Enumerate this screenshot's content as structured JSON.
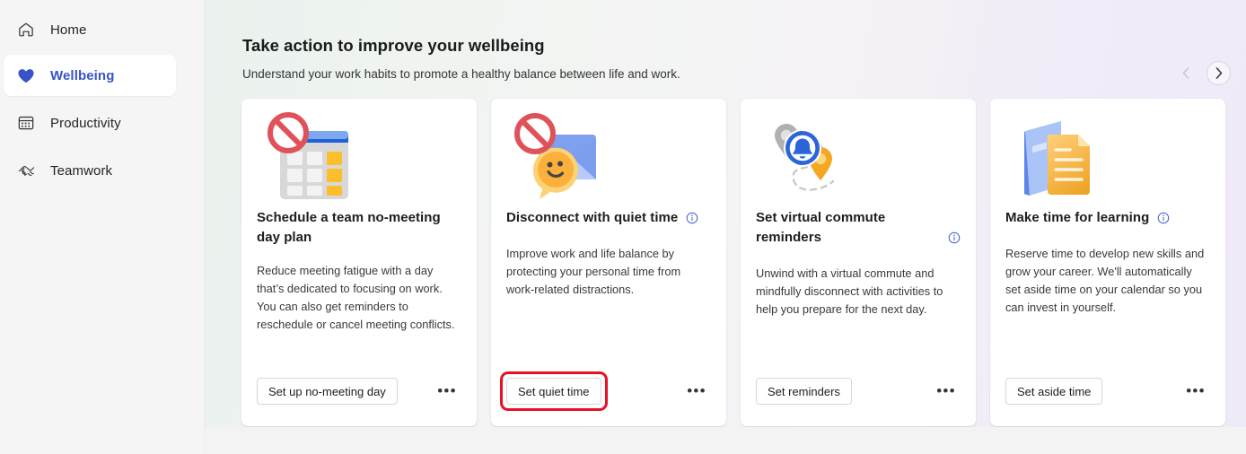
{
  "sidebar": {
    "items": [
      {
        "id": "home",
        "label": "Home",
        "icon": "home-icon",
        "active": false
      },
      {
        "id": "wellbeing",
        "label": "Wellbeing",
        "icon": "heart-icon",
        "active": true
      },
      {
        "id": "productivity",
        "label": "Productivity",
        "icon": "calendar-icon",
        "active": false
      },
      {
        "id": "teamwork",
        "label": "Teamwork",
        "icon": "handshake-icon",
        "active": false
      }
    ],
    "active_color": "#3754c8"
  },
  "header": {
    "title": "Take action to improve your wellbeing",
    "subtitle": "Understand your work habits to promote a healthy balance between life and work.",
    "prev_label": "‹",
    "next_label": "›"
  },
  "cards": [
    {
      "id": "no-meeting-day",
      "art": "calendar-blocked-illustration",
      "title": "Schedule a team no-meeting day plan",
      "body": "Reduce meeting fatigue with a day that’s dedicated to focusing on work. You can also get reminders to reschedule or cancel meeting conflicts.",
      "action": "Set up no-meeting day",
      "more": "•••",
      "has_info": false,
      "highlighted": false
    },
    {
      "id": "quiet-time",
      "art": "envelope-blocked-chat-illustration",
      "title": "Disconnect with quiet time",
      "body": "Improve work and life balance by protecting your personal time from work-related distractions.",
      "action": "Set quiet time",
      "more": "•••",
      "has_info": true,
      "highlighted": true
    },
    {
      "id": "virtual-commute",
      "art": "map-pins-bell-illustration",
      "title": "Set virtual commute reminders",
      "body": "Unwind with a virtual commute and mindfully disconnect with activities to help you prepare for the next day.",
      "action": "Set reminders",
      "more": "•••",
      "has_info": true,
      "highlighted": false
    },
    {
      "id": "learning-time",
      "art": "book-document-illustration",
      "title": "Make time for learning",
      "body": "Reserve time to develop new skills and grow your career. We'll automatically set aside time on your calendar so you can invest in yourself.",
      "action": "Set aside time",
      "more": "•••",
      "has_info": true,
      "highlighted": false
    }
  ],
  "colors": {
    "accent_blue": "#3754c8",
    "highlight_red": "#e81123",
    "illustration_blue": "#2b65d9",
    "illustration_yellow": "#f7b32b",
    "illustration_red": "#e0525a"
  }
}
